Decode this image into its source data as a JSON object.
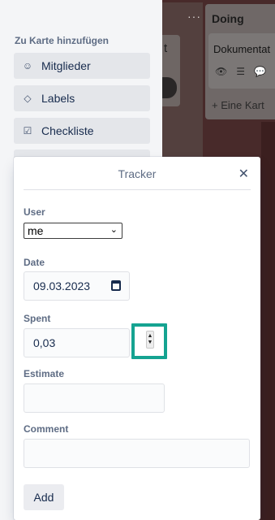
{
  "board": {
    "list_a": {
      "menu_glyph": "···",
      "card_glyph": "t"
    },
    "list_doing": {
      "title": "Doing",
      "card_title": "Dokumentat",
      "card_badges": [
        "eye-icon",
        "description-icon",
        "comment-icon"
      ],
      "add_card_label": "+ Eine Kart"
    }
  },
  "sidebar": {
    "heading": "Zu Karte hinzufügen",
    "items": [
      {
        "label": "Mitglieder",
        "icon": "person-icon"
      },
      {
        "label": "Labels",
        "icon": "tag-icon"
      },
      {
        "label": "Checkliste",
        "icon": "checkbox-icon"
      }
    ]
  },
  "tracker": {
    "title": "Tracker",
    "close_icon": "close-icon",
    "user": {
      "label": "User",
      "value": "me"
    },
    "date": {
      "label": "Date",
      "value": "09.03.2023"
    },
    "spent": {
      "label": "Spent",
      "value": "0,03"
    },
    "estimate": {
      "label": "Estimate",
      "value": ""
    },
    "comment": {
      "label": "Comment",
      "value": ""
    },
    "add_label": "Add",
    "highlight_color": "#15a391"
  }
}
